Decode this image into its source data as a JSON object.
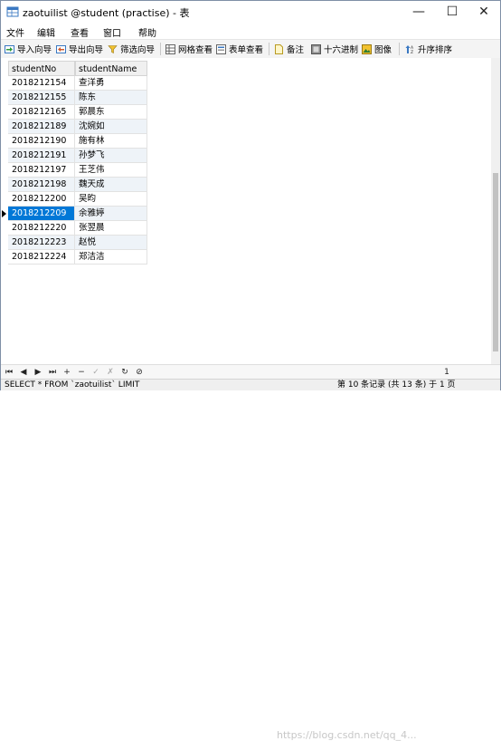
{
  "window": {
    "title": "zaotuilist @student (practise) - 表",
    "controls": {
      "minimize": "—",
      "maximize": "☐",
      "close": "✕"
    }
  },
  "menu": [
    "文件",
    "编辑",
    "查看",
    "窗口",
    "帮助"
  ],
  "toolbar": {
    "import_wizard": "导入向导",
    "export_wizard": "导出向导",
    "filter_wizard": "筛选向导",
    "grid_view": "网格查看",
    "form_view": "表单查看",
    "memo": "备注",
    "hex": "十六进制",
    "image": "图像",
    "sort_ascending": "升序排序"
  },
  "table": {
    "columns": [
      "studentNo",
      "studentName"
    ],
    "rows": [
      [
        "2018212154",
        "查洋勇"
      ],
      [
        "2018212155",
        "陈东"
      ],
      [
        "2018212165",
        "郭晨东"
      ],
      [
        "2018212189",
        "沈婉如"
      ],
      [
        "2018212190",
        "施有林"
      ],
      [
        "2018212191",
        "孙梦飞"
      ],
      [
        "2018212197",
        "王芝伟"
      ],
      [
        "2018212198",
        "魏天成"
      ],
      [
        "2018212200",
        "吴昀"
      ],
      [
        "2018212209",
        "余雅婷"
      ],
      [
        "2018212220",
        "张翌晨"
      ],
      [
        "2018212223",
        "赵悦"
      ],
      [
        "2018212224",
        "郑洁洁"
      ]
    ],
    "selected_row": 10
  },
  "navigation": {
    "buttons": [
      "⏮",
      "◀",
      "▶",
      "⏭",
      "+",
      "−",
      "✓",
      "✗",
      "↻",
      "⊘"
    ],
    "page": "1"
  },
  "status": {
    "sql": "SELECT * FROM `zaotuilist` LIMIT",
    "record_info": "第 10 条记录 (共 13 条) 于 1 页"
  },
  "watermark": "https://blog.csdn.net/qq_4...",
  "colors": {
    "selection": "#0078d7",
    "alt_row": "#eef3f8"
  }
}
